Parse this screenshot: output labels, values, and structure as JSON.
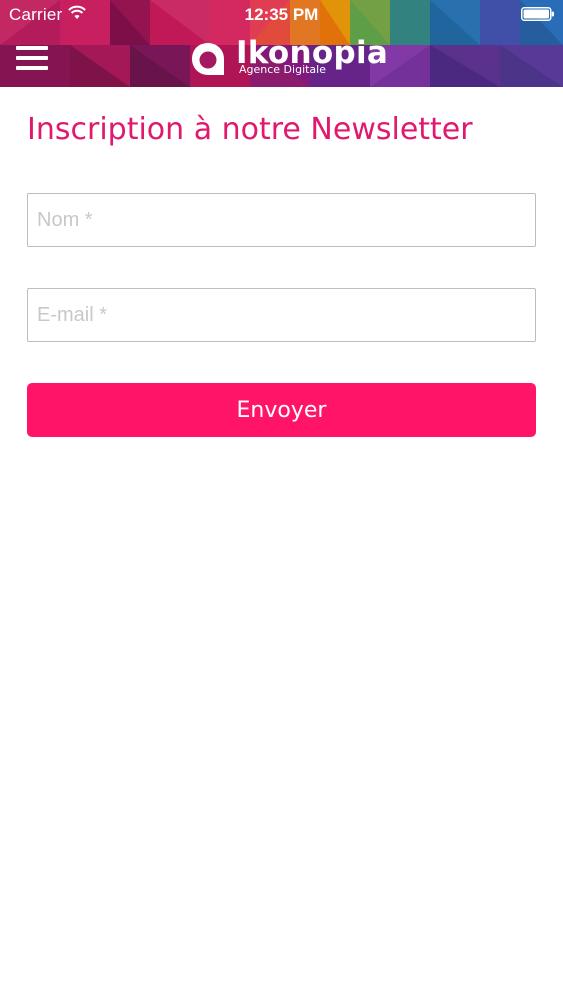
{
  "status_bar": {
    "carrier": "Carrier",
    "time": "12:35 PM",
    "wifi_icon": "wifi-icon",
    "battery_icon": "battery-icon"
  },
  "nav": {
    "menu_icon": "hamburger-menu-icon",
    "logo": {
      "name": "Ikonopia",
      "tagline": "Agence Digitale"
    }
  },
  "page": {
    "title": "Inscription à notre Newsletter"
  },
  "form": {
    "name_placeholder": "Nom *",
    "name_value": "",
    "email_placeholder": "E-mail *",
    "email_value": "",
    "submit_label": "Envoyer"
  },
  "colors": {
    "accent": "#ff1468",
    "title": "#e0196f",
    "field_border": "#bdbdbd",
    "placeholder": "#c8c8cc"
  }
}
